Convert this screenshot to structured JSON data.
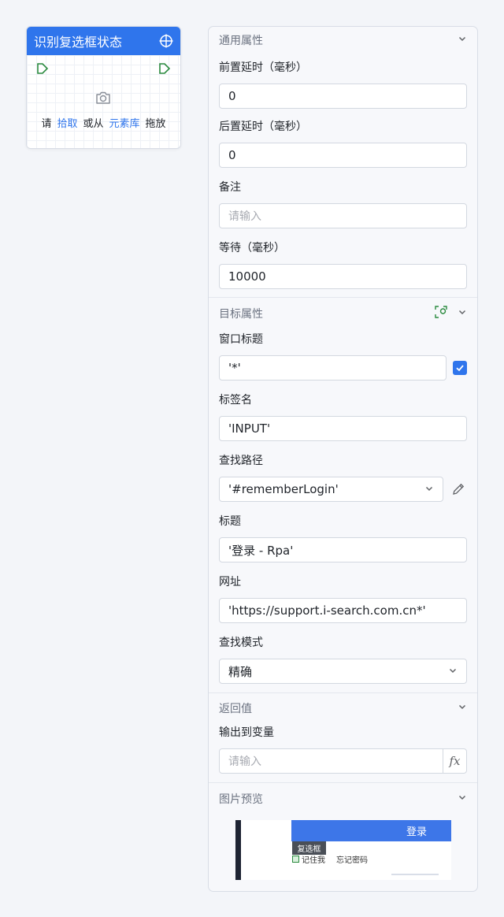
{
  "card": {
    "title": "识别复选框状态",
    "pick_prefix": "请",
    "pick_link": "拾取",
    "pick_middle": "或从",
    "library_link": "元素库",
    "pick_suffix": "拖放"
  },
  "panel": {
    "general": {
      "title": "通用属性",
      "pre_delay_label": "前置延时（毫秒）",
      "pre_delay_value": "0",
      "post_delay_label": "后置延时（毫秒）",
      "post_delay_value": "0",
      "remark_label": "备注",
      "remark_placeholder": "请输入",
      "wait_label": "等待（毫秒）",
      "wait_value": "10000"
    },
    "target": {
      "title": "目标属性",
      "window_title_label": "窗口标题",
      "window_title_value": "'*'",
      "window_title_checked": true,
      "tag_name_label": "标签名",
      "tag_name_value": "'INPUT'",
      "find_path_label": "查找路径",
      "find_path_value": "'#rememberLogin'",
      "heading_label": "标题",
      "heading_value": "'登录 - Rpa'",
      "url_label": "网址",
      "url_value": "'https://support.i-search.com.cn*'",
      "find_mode_label": "查找模式",
      "find_mode_value": "精确"
    },
    "return": {
      "title": "返回值",
      "output_label": "输出到变量",
      "output_placeholder": "请输入",
      "fx_label": "fx"
    },
    "preview": {
      "title": "图片预览",
      "login_text": "登录",
      "tooltip_text": "复选框",
      "checkbox_text": "记住我",
      "forgot_text": "忘记密码"
    }
  },
  "colors": {
    "accent": "#2f75ec",
    "port_green": "#2a8a3e"
  }
}
